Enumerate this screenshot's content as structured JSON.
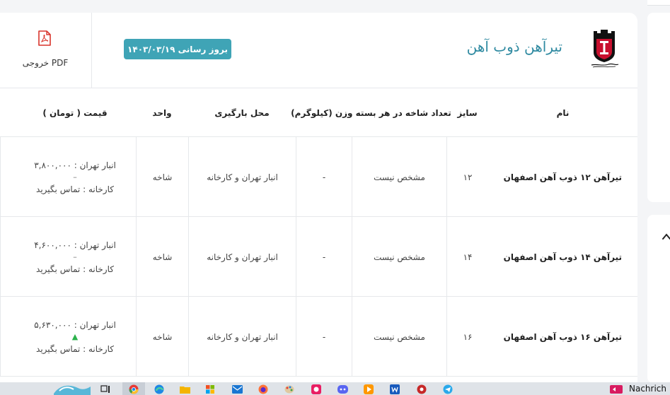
{
  "header": {
    "title": "تیرآهن ذوب آهن",
    "update_badge": "بروز رسانی ۱۴۰۳/۰۳/۱۹",
    "pdf_label": "خروجی PDF",
    "logo_icon": "esfahan-steel-logo-icon"
  },
  "table": {
    "columns": {
      "name": "نام",
      "size": "سایز",
      "count": "تعداد شاخه در هر بسته وزن (کیلوگرم)",
      "loading": "محل بارگیری",
      "unit": "واحد",
      "price": "قیمت ( تومان )"
    },
    "rows": [
      {
        "name": "تیرآهن ۱۲ ذوب آهن اصفهان",
        "size": "۱۲",
        "count": "مشخص نیست",
        "weight": "-",
        "loading": "انبار تهران و کارخانه",
        "unit": "شاخه",
        "price_warehouse": "انبار تهران : ۳,۸۰۰,۰۰۰",
        "trend": "–",
        "price_factory": "کارخانه : تماس بگیرید"
      },
      {
        "name": "تیرآهن ۱۴ ذوب آهن اصفهان",
        "size": "۱۴",
        "count": "مشخص نیست",
        "weight": "-",
        "loading": "انبار تهران و کارخانه",
        "unit": "شاخه",
        "price_warehouse": "انبار تهران : ۴,۶۰۰,۰۰۰",
        "trend": "–",
        "price_factory": "کارخانه : تماس بگیرید"
      },
      {
        "name": "تیرآهن ۱۶ ذوب آهن اصفهان",
        "size": "۱۶",
        "count": "مشخص نیست",
        "weight": "-",
        "loading": "انبار تهران و کارخانه",
        "unit": "شاخه",
        "price_warehouse": "انبار تهران : ۵,۶۳۰,۰۰۰",
        "trend": "▲",
        "price_factory": "کارخانه : تماس بگیرید"
      }
    ]
  },
  "taskbar": {
    "notification_text": "Nachrich"
  },
  "colors": {
    "accent": "#3fa4b6",
    "title": "#2f8aa1",
    "pdf_red": "#d9342b",
    "up_green": "#2bb24c"
  }
}
